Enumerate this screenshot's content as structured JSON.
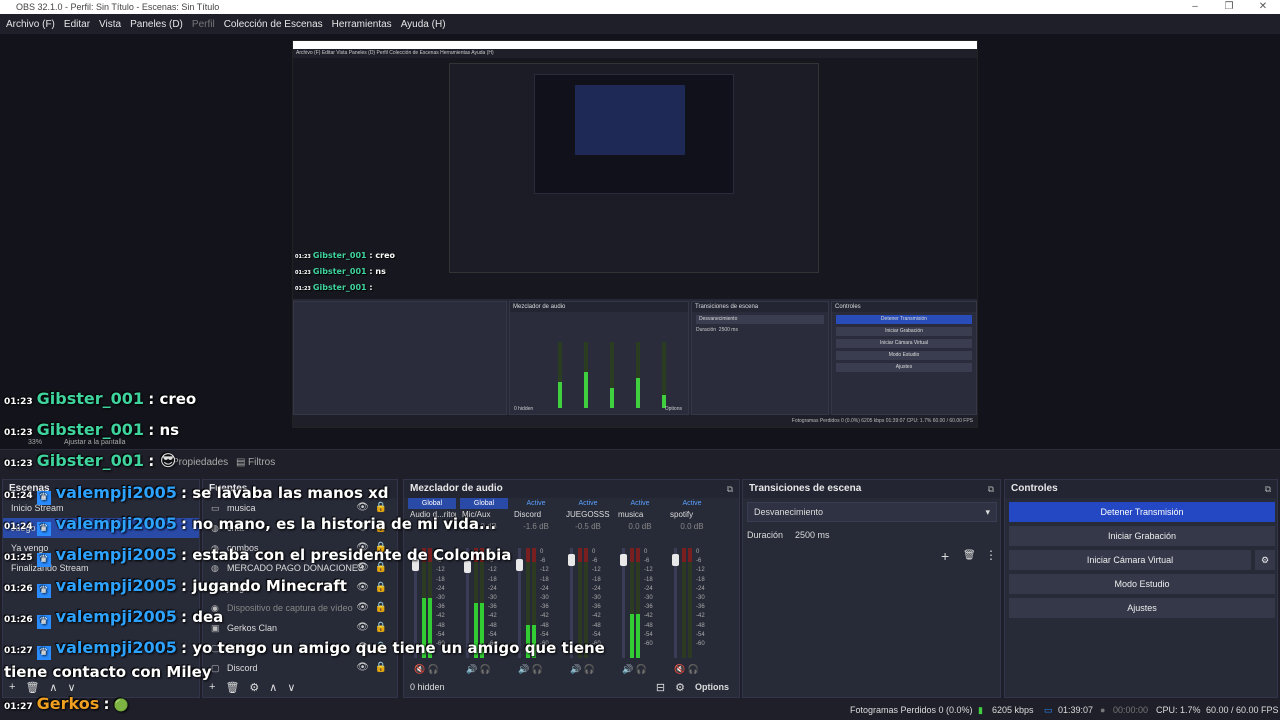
{
  "window": {
    "title": "OBS 32.1.0 - Perfil: Sin Título - Escenas: Sin Título",
    "controls": [
      "–",
      "❐",
      "✕"
    ]
  },
  "menu": [
    "Archivo (F)",
    "Editar",
    "Vista",
    "Paneles (D)",
    "Perfil",
    "Colección de Escenas",
    "Herramientas",
    "Ayuda (H)"
  ],
  "preview": {
    "menu": "Archivo (F)   Editar   Vista   Paneles (D)   Perfil   Colección de Escenas   Herramientas   Ayuda (H)",
    "chat": [
      {
        "time": "01:23",
        "user": "Gibster_001",
        "msg": ": creo"
      },
      {
        "time": "01:23",
        "user": "Gibster_001",
        "msg": ": ns"
      },
      {
        "time": "01:23",
        "user": "Gibster_001",
        "msg": ":"
      },
      {
        "time": "",
        "user": "valempji2005",
        "msg": ": se lavaba las manos xd"
      },
      {
        "time": "",
        "user": "valempji2005",
        "msg": ": no mano, es la historia de mi vida..."
      },
      {
        "time": "01:25",
        "user": "valempji2005",
        "msg": ": estaba con el presidente de Colombia"
      },
      {
        "time": "01:26",
        "user": "valempji2005",
        "msg": ": jugando Minecraft"
      },
      {
        "time": "01:26",
        "user": "valempji2005",
        "msg": ": dea"
      },
      {
        "time": "01:27",
        "user": "valempji2005",
        "msg": ": yo tengo un amigo que tiene un amigo que tiene"
      },
      {
        "time": "",
        "user": "",
        "msg": "tiene contacto con Miley"
      },
      {
        "time": "01:27",
        "user": "Gerkos",
        "msg": ":"
      }
    ],
    "docks": {
      "mixer": "Mezclador de audio",
      "transitions": "Transiciones de escena",
      "controls": "Controles",
      "transition_value": "Desvanecimiento",
      "duration_label": "Duración",
      "duration_value": "2500 ms",
      "buttons": [
        "Detener Transmisión",
        "Iniciar Grabación",
        "Iniciar Cámara Virtual",
        "Modo Estudio",
        "Ajustes"
      ],
      "hidden": "0 hidden",
      "options": "Options"
    },
    "status": "Fotogramas Perdidos 0 (0.0%)   6205 kbps   01:39:07   CPU: 1.7%   60.00 / 60.00 FPS"
  },
  "toolbar": {
    "properties": "Propiedades",
    "filters": "Filtros",
    "zoom": "33%",
    "fit": "Ajustar a la pantalla"
  },
  "scenes": {
    "title": "Escenas",
    "items": [
      "Inicio Stream",
      "Juego",
      "Ya vengo",
      "Finalizando Stream"
    ]
  },
  "sources": {
    "title": "Fuentes",
    "items": [
      {
        "name": "musica",
        "icon": "monitor-icon",
        "dim": false
      },
      {
        "name": "chat",
        "icon": "browser-icon",
        "dim": false
      },
      {
        "name": "combos",
        "icon": "browser-icon",
        "dim": false
      },
      {
        "name": "MERCADO PAGO DONACIONES",
        "icon": "browser-icon",
        "dim": false
      },
      {
        "name": "juego",
        "icon": "game-icon",
        "dim": false
      },
      {
        "name": "Dispositivo de captura de vídeo",
        "icon": "camera-icon",
        "dim": true
      },
      {
        "name": "Gerkos Clan",
        "icon": "image-icon",
        "dim": false
      },
      {
        "name": "Spotify",
        "icon": "window-icon",
        "dim": false
      },
      {
        "name": "Discord",
        "icon": "window-icon",
        "dim": false
      }
    ]
  },
  "mixer": {
    "title": "Mezclador de audio",
    "channels": [
      {
        "status": "Global",
        "name": "Audio d...ritorio",
        "db": "",
        "level": 0.55,
        "fader": 0.1,
        "muted": true
      },
      {
        "status": "Global",
        "name": "Mic/Aux",
        "db": "-2.0 dB",
        "level": 0.5,
        "fader": 0.12,
        "muted": false
      },
      {
        "status": "Active",
        "name": "Discord",
        "db": "-1.6 dB",
        "level": 0.3,
        "fader": 0.1,
        "muted": false
      },
      {
        "status": "Active",
        "name": "JUEGOSSS",
        "db": "-0.5 dB",
        "level": 0.0,
        "fader": 0.05,
        "muted": false
      },
      {
        "status": "Active",
        "name": "musica",
        "db": "0.0 dB",
        "level": 0.4,
        "fader": 0.05,
        "muted": false
      },
      {
        "status": "Active",
        "name": "spotify",
        "db": "0.0 dB",
        "level": 0.0,
        "fader": 0.05,
        "muted": true
      }
    ],
    "scale": [
      "0",
      "-6",
      "-12",
      "-18",
      "-24",
      "-30",
      "-36",
      "-42",
      "-48",
      "-54",
      "-60"
    ],
    "hidden": "0 hidden",
    "options": "Options"
  },
  "transitions": {
    "title": "Transiciones de escena",
    "value": "Desvanecimiento",
    "duration_label": "Duración",
    "duration_value": "2500 ms"
  },
  "controls": {
    "title": "Controles",
    "stop_stream": "Detener Transmisión",
    "start_record": "Iniciar Grabación",
    "virtual_cam": "Iniciar Cámara Virtual",
    "studio_mode": "Modo Estudio",
    "settings": "Ajustes"
  },
  "chat": {
    "lines": [
      {
        "time": "01:23",
        "user": "Gibster_001",
        "msg": ": creo",
        "color": "#3fd39e",
        "icon": false
      },
      {
        "time": "01:23",
        "user": "Gibster_001",
        "msg": ": ns",
        "color": "#3fd39e",
        "icon": false
      },
      {
        "time": "01:23",
        "user": "Gibster_001",
        "msg": ":",
        "color": "#3fd39e",
        "icon": false
      },
      {
        "time": "01:24",
        "user": "valempji2005",
        "msg": ": se lavaba las manos xd",
        "color": "#2da3ff",
        "icon": true
      },
      {
        "time": "01:24",
        "user": "valempji2005",
        "msg": ": no mano, es la historia de mi vida...",
        "color": "#2da3ff",
        "icon": true
      },
      {
        "time": "01:25",
        "user": "valempji2005",
        "msg": ": estaba con el presidente de Colombia",
        "color": "#2da3ff",
        "icon": true
      },
      {
        "time": "01:26",
        "user": "valempji2005",
        "msg": ": jugando Minecraft",
        "color": "#2da3ff",
        "icon": true
      },
      {
        "time": "01:26",
        "user": "valempji2005",
        "msg": ": dea",
        "color": "#2da3ff",
        "icon": true
      },
      {
        "time": "01:27",
        "user": "valempji2005",
        "msg": ": yo tengo un amigo que tiene un amigo que tiene",
        "color": "#2da3ff",
        "icon": true
      },
      {
        "time": "",
        "user": "",
        "msg": "tiene contacto con Miley",
        "color": "#2da3ff",
        "icon": false
      },
      {
        "time": "01:27",
        "user": "Gerkos",
        "msg": ":",
        "color": "#f0a020",
        "icon": false
      }
    ]
  },
  "status": {
    "dropped": "Fotogramas Perdidos 0 (0.0%)",
    "bitrate": "6205 kbps",
    "stream_time": "01:39:07",
    "rec_time": "00:00:00",
    "cpu": "CPU: 1.7%",
    "fps": "60.00 / 60.00 FPS"
  },
  "colors": {
    "accent": "#2448c4",
    "live": "#2a8cff",
    "meter": "#32cd32"
  }
}
